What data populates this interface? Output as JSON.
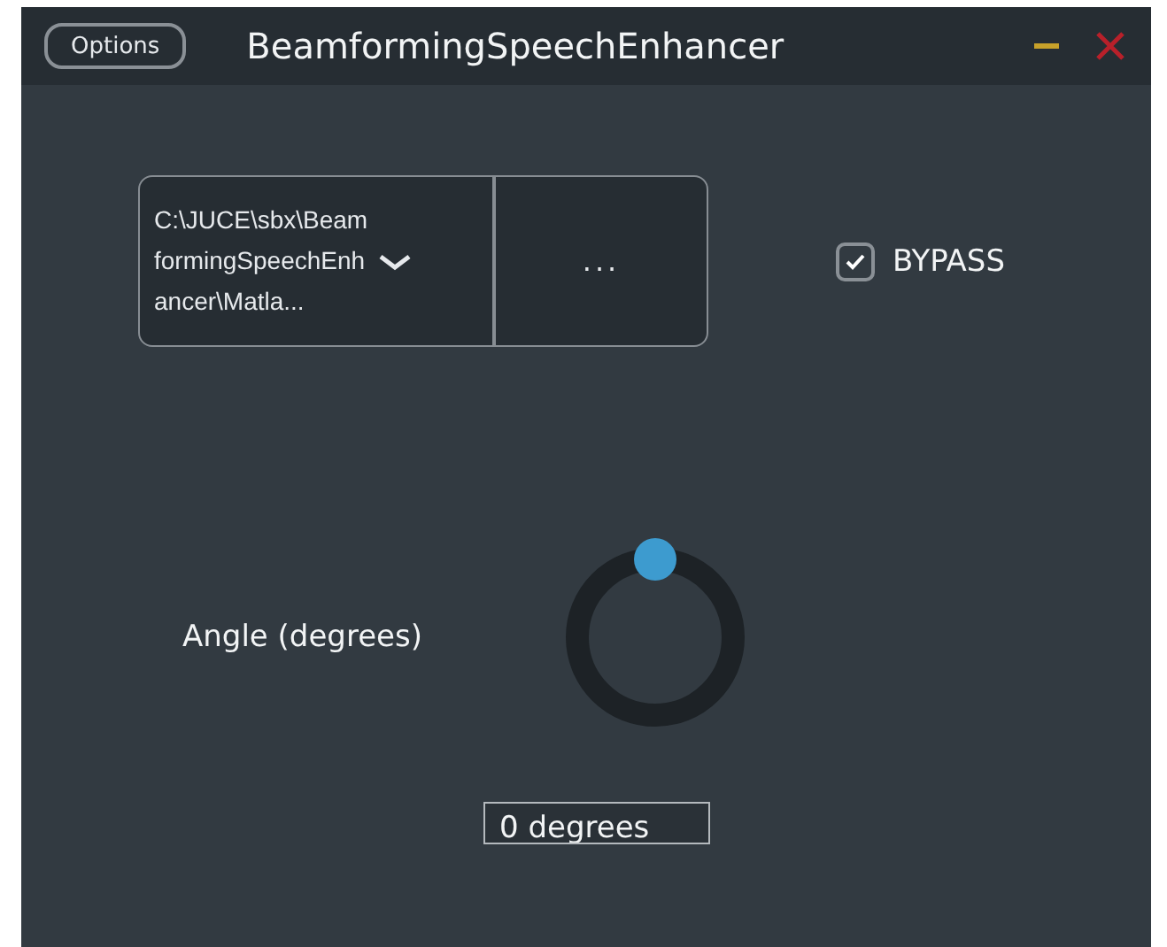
{
  "window": {
    "title": "BeamformingSpeechEnhancer",
    "options_button": "Options"
  },
  "file_combo": {
    "value": "C:\\JUCE\\sbx\\BeamformingSpeechEnhancer\\Matla..."
  },
  "browse_button": {
    "label": "..."
  },
  "bypass": {
    "label": "BYPASS",
    "checked": true
  },
  "angle": {
    "label": "Angle (degrees)",
    "level": 0.5,
    "value": "0 degrees"
  }
}
